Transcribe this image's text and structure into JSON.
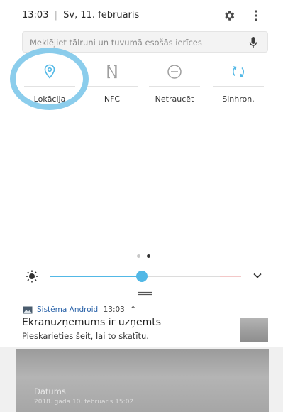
{
  "status_bar": {
    "time": "13:03",
    "date": "Sv, 11. februāris"
  },
  "search": {
    "placeholder": "Meklējiet tālruni un tuvumā esošās ierīces"
  },
  "quick_tiles": [
    {
      "label": "Lokācija",
      "icon": "location-pin-icon",
      "active": true
    },
    {
      "label": "NFC",
      "icon": "nfc-icon",
      "active": false
    },
    {
      "label": "Netraucēt",
      "icon": "do-not-disturb-icon",
      "active": false
    },
    {
      "label": "Sinhron.",
      "icon": "sync-icon",
      "active": true
    }
  ],
  "pager": {
    "pages": 2,
    "current": 2
  },
  "brightness": {
    "level": 0.48
  },
  "notification": {
    "app_name": "Sistēma Android",
    "time": "13:03",
    "title": "Ekrānuzņēmums ir uzņemts",
    "body": "Pieskarieties šeit, lai to skatītu."
  },
  "preview": {
    "title": "Datums",
    "subtitle": "2018. gada 10. februāris 15:02"
  },
  "colors": {
    "accent": "#52b8e6",
    "inactive_icon": "#9e9e9e",
    "highlight_circle": "#7ec8ea"
  }
}
